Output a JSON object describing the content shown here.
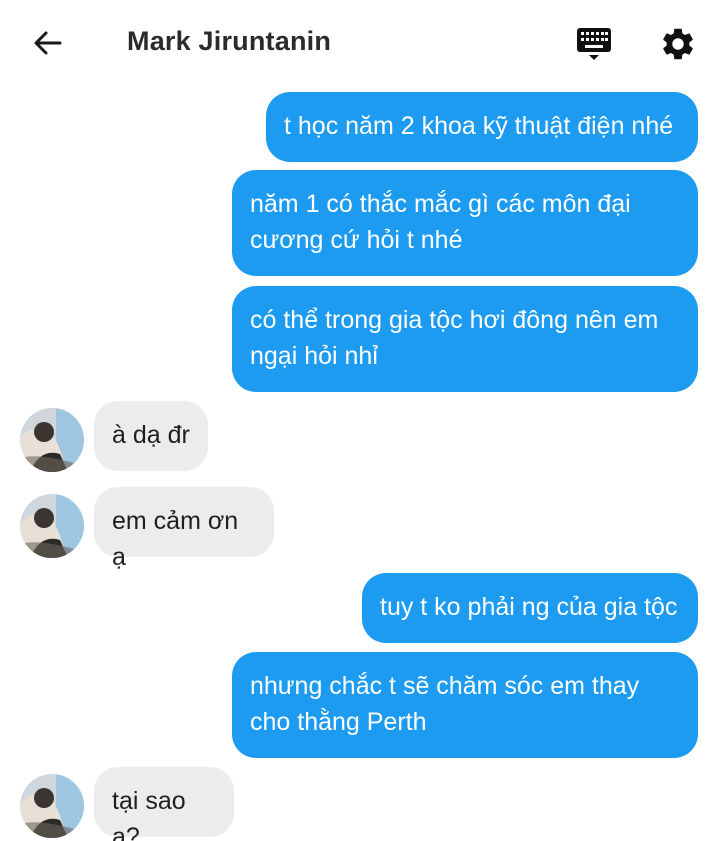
{
  "header": {
    "title": "Mark Jiruntanin",
    "back_icon": "arrow-left-icon",
    "keyboard_icon": "keyboard-icon",
    "settings_icon": "gear-icon"
  },
  "colors": {
    "outgoing_bubble": "#1c9bf0",
    "incoming_bubble": "#ececec"
  },
  "messages": [
    {
      "direction": "out",
      "lines": [
        "t học năm 2 khoa kỹ thuật điện nhé"
      ]
    },
    {
      "direction": "out",
      "lines": [
        "năm 1 có thắc mắc gì các môn đại",
        "cương cứ hỏi t nhé"
      ]
    },
    {
      "direction": "out",
      "lines": [
        "có thể trong gia tộc hơi đông nên em",
        "ngại hỏi nhỉ"
      ]
    },
    {
      "direction": "in",
      "lines": [
        "à dạ đr"
      ]
    },
    {
      "direction": "in",
      "lines": [
        "em cảm ơn ạ"
      ]
    },
    {
      "direction": "out",
      "lines": [
        "tuy t ko phải ng của gia tộc"
      ]
    },
    {
      "direction": "out",
      "lines": [
        "nhưng chắc t sẽ chăm sóc em thay",
        "cho thằng Perth"
      ]
    },
    {
      "direction": "in",
      "lines": [
        "tại sao ạ?"
      ]
    }
  ]
}
